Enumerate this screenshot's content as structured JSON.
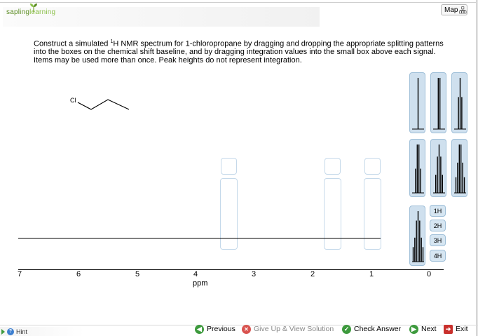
{
  "logo": {
    "first": "sapling",
    "second": "learning"
  },
  "map_button": {
    "label": "Map"
  },
  "instructions": {
    "line1_pre": "Construct a simulated ",
    "sup": "1",
    "line1_post": "H NMR spectrum for 1-chloropropane by dragging and dropping the appropriate splitting patterns into the boxes on the chemical shift baseline, and by dragging integration values into the small box above each signal. Items may be used more than once. Peak heights do not represent integration."
  },
  "molecule": {
    "atom_label": "Cl"
  },
  "splitting_patterns": [
    "singlet",
    "doublet",
    "triplet",
    "quartet",
    "quintet",
    "sextet",
    "septet"
  ],
  "integration_values": [
    "1H",
    "2H",
    "3H",
    "4H"
  ],
  "axis": {
    "ticks": [
      "7",
      "6",
      "5",
      "4",
      "3",
      "2",
      "1",
      "0"
    ],
    "label": "ppm"
  },
  "footer": {
    "hint": "Hint",
    "previous": "Previous",
    "give_up": "Give Up & View Solution",
    "check": "Check Answer",
    "next": "Next",
    "exit": "Exit"
  },
  "colors": {
    "accent_green": "#3d9a3d",
    "pattern_bg": "#cfe0ee",
    "pattern_border": "#9fbfd8",
    "drop_border": "#c5d9ea"
  }
}
